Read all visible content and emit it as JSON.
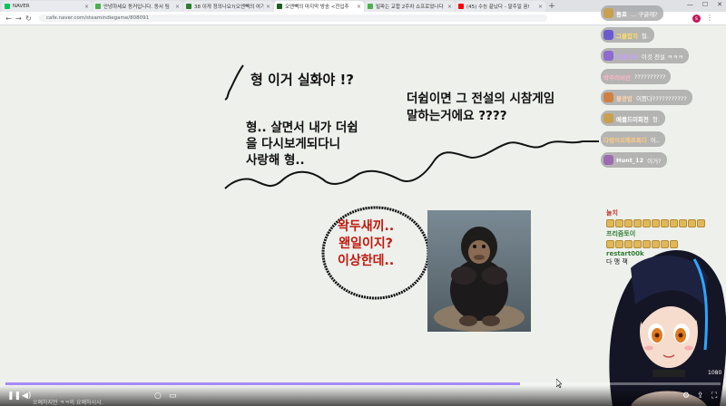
{
  "browser": {
    "tabs": [
      {
        "label": "NAVER",
        "color": "#03c75a",
        "active": false
      },
      {
        "label": "안녕하세요 동커입니다. 동서 팀",
        "color": "#4caf50",
        "active": false
      },
      {
        "label": "38 이게 정의나요?(오엔빽의 여기",
        "color": "#2e7d32",
        "active": false
      },
      {
        "label": "오엔빽의 마지막 방송 <전입추",
        "color": "#1b5e20",
        "active": true
      },
      {
        "label": "빌파는 교합 2주차 쇼프로었나다",
        "color": "#4caf50",
        "active": false
      },
      {
        "label": "(45) 수능 끝났다 - 말주일 꿈!",
        "color": "#ff0000",
        "active": false
      }
    ],
    "new_tab": "+",
    "url": "cafe.naver.com/steamindiegame/808091",
    "profile_initial": "s"
  },
  "canvas": {
    "text1": "형 이거 실화야 !?",
    "text2_lines": [
      "형.. 살면서 내가 더쉽",
      "을 다시보게되다니",
      "사랑해 형.."
    ],
    "text3_lines": [
      "더쉽이면 그 전설의 시참게임",
      "말하는거에요 ????"
    ],
    "text4_lines": [
      "왁두새끼..",
      "왠일이지?",
      "이상한데.."
    ]
  },
  "chat_bubbles": [
    {
      "name": "동호",
      "msg": "... 구글레?",
      "name_color": "#ffffff"
    },
    {
      "name": "그물잡지",
      "msg": "철.",
      "name_color": "#ffe066"
    },
    {
      "name": "오동나무",
      "msg": "이것 전설 ㅋㅋㅋ",
      "name_color": "#c9a0ff"
    },
    {
      "name": "박주의비선",
      "msg": "??????????",
      "name_color": "#ffb3c6"
    },
    {
      "name": "불광밥",
      "msg": "이쯤다???????????",
      "name_color": "#ffd4a8"
    },
    {
      "name": "메클드미회전",
      "msg": "형.",
      "name_color": "#ffffff"
    },
    {
      "name": "다람어오해르폭디",
      "msg": "어..",
      "name_color": "#ffcc80"
    },
    {
      "name": "Hunt_12",
      "msg": "이거?",
      "name_color": "#ffffff"
    }
  ],
  "stream_chat": [
    {
      "name": "눌치",
      "name_color": "#c0392b",
      "emotes": 11,
      "msg": ""
    },
    {
      "name": "프리즘토이",
      "name_color": "#2e7d32",
      "emotes": 8,
      "msg": ""
    },
    {
      "name": "restart00k",
      "name_color": "#2e7d32",
      "emotes": 0,
      "msg": "다 맹 잭"
    }
  ],
  "video": {
    "progress": 0.72,
    "quality_badge": "1080",
    "taskbar_text": "오예하지만 ㅋㅋ의 요예하시시."
  }
}
